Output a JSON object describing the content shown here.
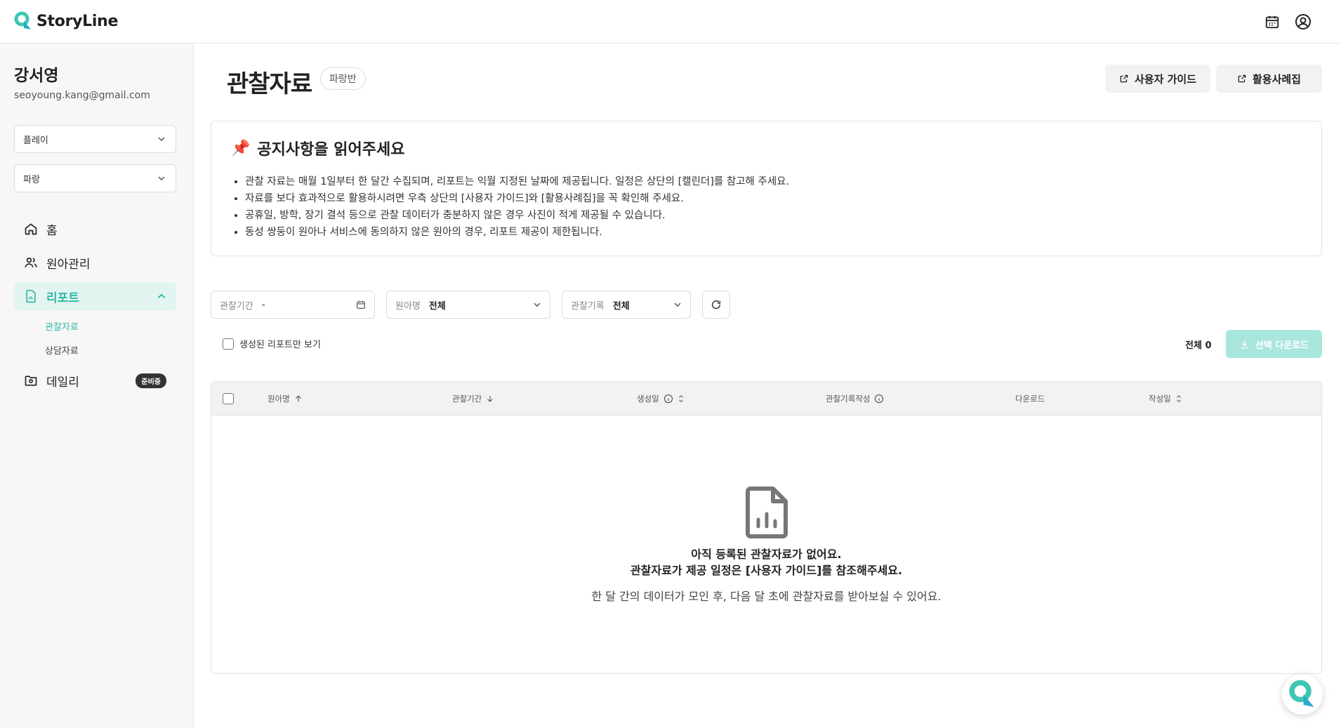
{
  "app": {
    "name": "StoryLine"
  },
  "header": {
    "calendar_icon": "calendar-icon",
    "account_icon": "user-circle-icon"
  },
  "sidebar": {
    "user_name": "강서영",
    "user_email": "seoyoung.kang@gmail.com",
    "select_org": "플레이",
    "select_class": "파랑",
    "nav": {
      "home": "홈",
      "children": "원아관리",
      "report": "리포트",
      "report_sub_observation": "관찰자료",
      "report_sub_counsel": "상담자료",
      "daily": "데일리",
      "daily_badge": "준비중"
    }
  },
  "main": {
    "title": "관찰자료",
    "class_chip": "파랑반",
    "guide_button": "사용자 가이드",
    "cases_button": "활용사례집",
    "notice": {
      "emoji": "📌",
      "title": "공지사항을 읽어주세요",
      "items": [
        "관찰 자료는 매월 1일부터 한 달간 수집되며, 리포트는 익월 지정된 날짜에 제공됩니다. 일정은 상단의 [캘린더]를 참고해 주세요.",
        "자료를 보다 효과적으로 활용하시려면 우측 상단의 [사용자 가이드]와 [활용사례집]을 꼭 확인해 주세요.",
        "공휴일, 방학, 장기 결석 등으로 관찰 데이터가 충분하지 않은 경우 사진이 적게 제공될 수 있습니다.",
        "동성 쌍둥이 원아나 서비스에 동의하지 않은 원아의 경우, 리포트 제공이 제한됩니다."
      ]
    },
    "filters": {
      "period_label": "관찰기간",
      "period_value": "-",
      "child_label": "원아명",
      "child_value": "전체",
      "record_label": "관찰기록",
      "record_value": "전체"
    },
    "only_generated_label": "생성된 리포트만 보기",
    "total_label": "전체 0",
    "download_selected": "선택 다운로드",
    "table": {
      "columns": [
        "원아명",
        "관찰기간",
        "생성일",
        "관찰기록작성",
        "다운로드",
        "작성일"
      ]
    },
    "empty": {
      "line1": "아직 등록된 관찰자료가 없어요.",
      "line2": "관찰자료가 제공 일정은 [사용자 가이드]를 참조해주세요.",
      "line3": "한 달 간의 데이터가 모인 후, 다음 달 초에 관찰자료를 받아보실 수 있어요."
    }
  },
  "colors": {
    "accent": "#35b8a6",
    "accent_light": "#e3f5f1",
    "download_disabled": "#a9e6dc"
  }
}
